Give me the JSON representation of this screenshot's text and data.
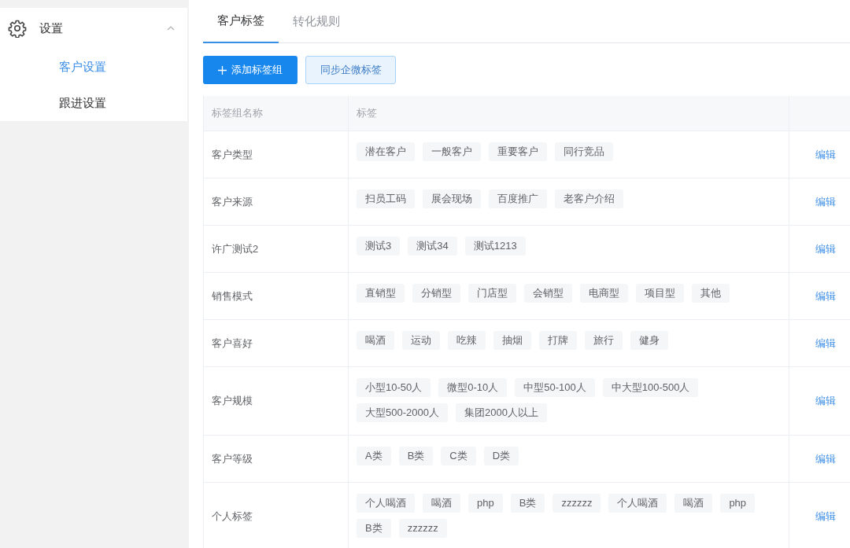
{
  "sidebar": {
    "menu": {
      "label": "设置",
      "expanded": true,
      "children": [
        {
          "label": "客户设置",
          "selected": true
        },
        {
          "label": "跟进设置",
          "selected": false
        }
      ]
    }
  },
  "tabs": [
    {
      "label": "客户标签",
      "selected": true
    },
    {
      "label": "转化规则",
      "selected": false
    }
  ],
  "toolbar": {
    "buttons": [
      {
        "label": "添加标签组",
        "kind": "primary"
      },
      {
        "label": "同步企微标签",
        "kind": "secondary"
      }
    ]
  },
  "table": {
    "columns": [
      "标签组名称",
      "标签"
    ],
    "rows": [
      {
        "name": "客户类型",
        "tags": [
          "潜在客户",
          "一般客户",
          "重要客户",
          "同行竞品"
        ],
        "action": "编辑"
      },
      {
        "name": "客户来源",
        "tags": [
          "扫员工码",
          "展会现场",
          "百度推广",
          "老客户介绍"
        ],
        "action": "编辑"
      },
      {
        "name": "许广测试2",
        "tags": [
          "测试3",
          "测试34",
          "测试1213"
        ],
        "action": "编辑"
      },
      {
        "name": "销售模式",
        "tags": [
          "直销型",
          "分销型",
          "门店型",
          "会销型",
          "电商型",
          "项目型",
          "其他"
        ],
        "action": "编辑"
      },
      {
        "name": "客户喜好",
        "tags": [
          "喝酒",
          "运动",
          "吃辣",
          "抽烟",
          "打牌",
          "旅行",
          "健身"
        ],
        "action": "编辑"
      },
      {
        "name": "客户规模",
        "tags": [
          "小型10-50人",
          "微型0-10人",
          "中型50-100人",
          "中大型100-500人",
          "大型500-2000人",
          "集团2000人以上"
        ],
        "action": "编辑"
      },
      {
        "name": "客户等级",
        "tags": [
          "A类",
          "B类",
          "C类",
          "D类"
        ],
        "action": "编辑"
      },
      {
        "name": "个人标签",
        "tags": [
          "个人喝酒",
          "喝酒",
          "php",
          "B类",
          "zzzzzz",
          "个人喝酒",
          "喝酒",
          "php",
          "B类",
          "zzzzzz"
        ],
        "action": "编辑"
      }
    ]
  }
}
